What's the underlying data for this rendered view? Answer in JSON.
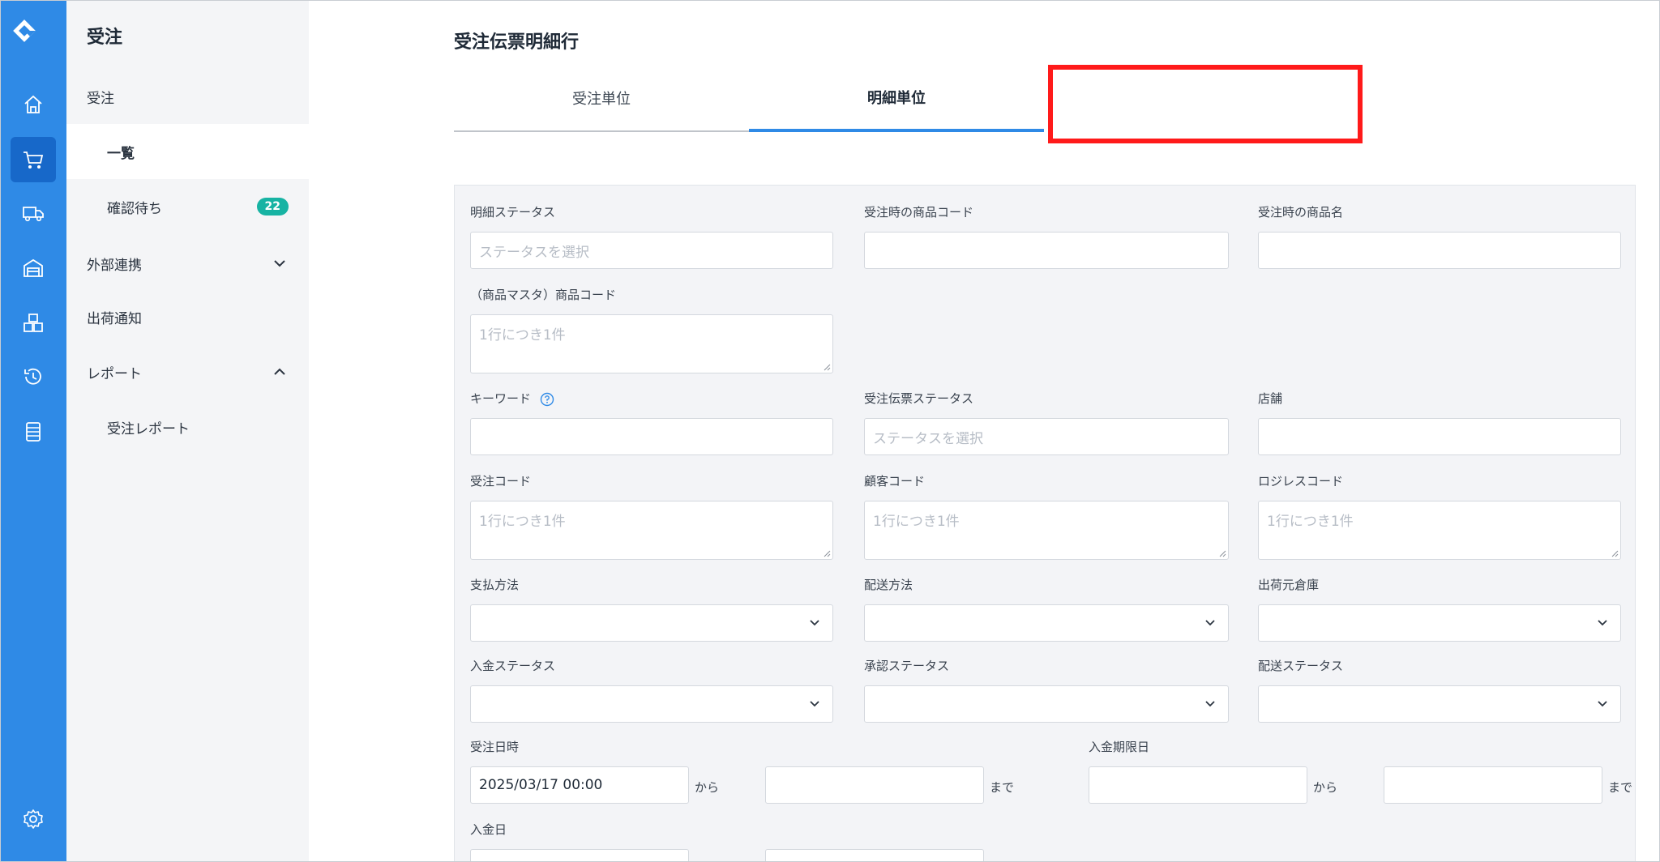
{
  "sidebar": {
    "title": "受注",
    "items": [
      {
        "label": "受注"
      },
      {
        "label": "一覧"
      },
      {
        "label": "確認待ち",
        "badge": "22"
      },
      {
        "label": "外部連携"
      },
      {
        "label": "出荷通知"
      },
      {
        "label": "レポート"
      },
      {
        "label": "受注レポート"
      }
    ]
  },
  "rail_icons": [
    "home-icon",
    "cart-icon",
    "truck-icon",
    "warehouse-icon",
    "boxes-icon",
    "history-icon",
    "list-icon",
    "gear-icon"
  ],
  "page": {
    "title": "受注伝票明細行",
    "tabs": [
      {
        "label": "受注単位"
      },
      {
        "label": "明細単位"
      }
    ]
  },
  "form": {
    "line_status": {
      "label": "明細ステータス",
      "placeholder": "ステータスを選択"
    },
    "ordered_item_code": {
      "label": "受注時の商品コード"
    },
    "ordered_item_name": {
      "label": "受注時の商品名"
    },
    "master_item_code": {
      "label": "（商品マスタ）商品コード",
      "placeholder": "1行につき1件"
    },
    "keyword": {
      "label": "キーワード"
    },
    "slip_status": {
      "label": "受注伝票ステータス",
      "placeholder": "ステータスを選択"
    },
    "store": {
      "label": "店舗"
    },
    "order_code": {
      "label": "受注コード",
      "placeholder": "1行につき1件"
    },
    "customer_code": {
      "label": "顧客コード",
      "placeholder": "1行につき1件"
    },
    "logiless_code": {
      "label": "ロジレスコード",
      "placeholder": "1行につき1件"
    },
    "payment_method": {
      "label": "支払方法"
    },
    "delivery_method": {
      "label": "配送方法"
    },
    "warehouse": {
      "label": "出荷元倉庫"
    },
    "payment_status": {
      "label": "入金ステータス"
    },
    "approval_status": {
      "label": "承認ステータス"
    },
    "delivery_status": {
      "label": "配送ステータス"
    },
    "order_datetime": {
      "label": "受注日時",
      "from_value": "2025/03/17 00:00",
      "from_suffix": "から",
      "to_suffix": "まで"
    },
    "payment_due": {
      "label": "入金期限日",
      "from_suffix": "から",
      "to_suffix": "まで"
    },
    "payment_date": {
      "label": "入金日"
    }
  },
  "colors": {
    "rail": "#2f8ae6",
    "accent": "#2f8ae6",
    "highlight": "#ff1a1a",
    "badge": "#17b3a3"
  }
}
